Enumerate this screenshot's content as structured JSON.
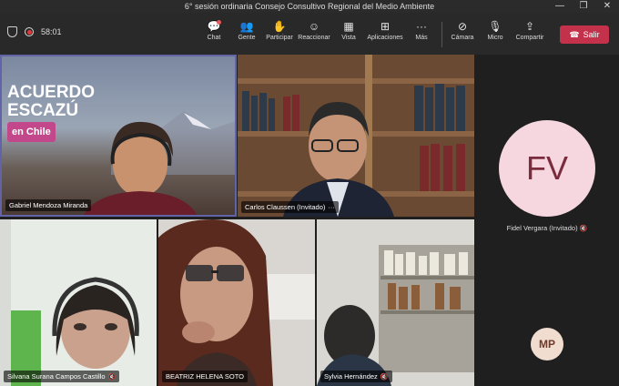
{
  "window": {
    "title": "6° sesión ordinaria Consejo Consultivo Regional del Medio Ambiente"
  },
  "meeting": {
    "timer": "58:01"
  },
  "toolbar": {
    "chat": "Chat",
    "people": "Gente",
    "participate": "Participar",
    "react": "Reaccionar",
    "view": "Vista",
    "apps": "Aplicaciones",
    "more": "Más",
    "camera": "Cámara",
    "mic": "Micro",
    "share": "Compartir",
    "leave": "Salir"
  },
  "banner": {
    "line1": "ACUERDO",
    "line2": "ESCAZÚ",
    "line3": "en Chile"
  },
  "participants": [
    {
      "name": "Gabriel Mendoza Miranda"
    },
    {
      "name": "Carlos Claussen (Invitado)"
    },
    {
      "name": "Fidel Vergara (Invitado)",
      "initials": "FV"
    },
    {
      "name": "Silvana Surana Campos Castillo"
    },
    {
      "name": "BEATRIZ HELENA SOTO"
    },
    {
      "name": "Sylvia Hernández"
    },
    {
      "initials": "MP"
    }
  ],
  "colors": {
    "leave": "#c4314b",
    "active_border": "#6264a7"
  }
}
